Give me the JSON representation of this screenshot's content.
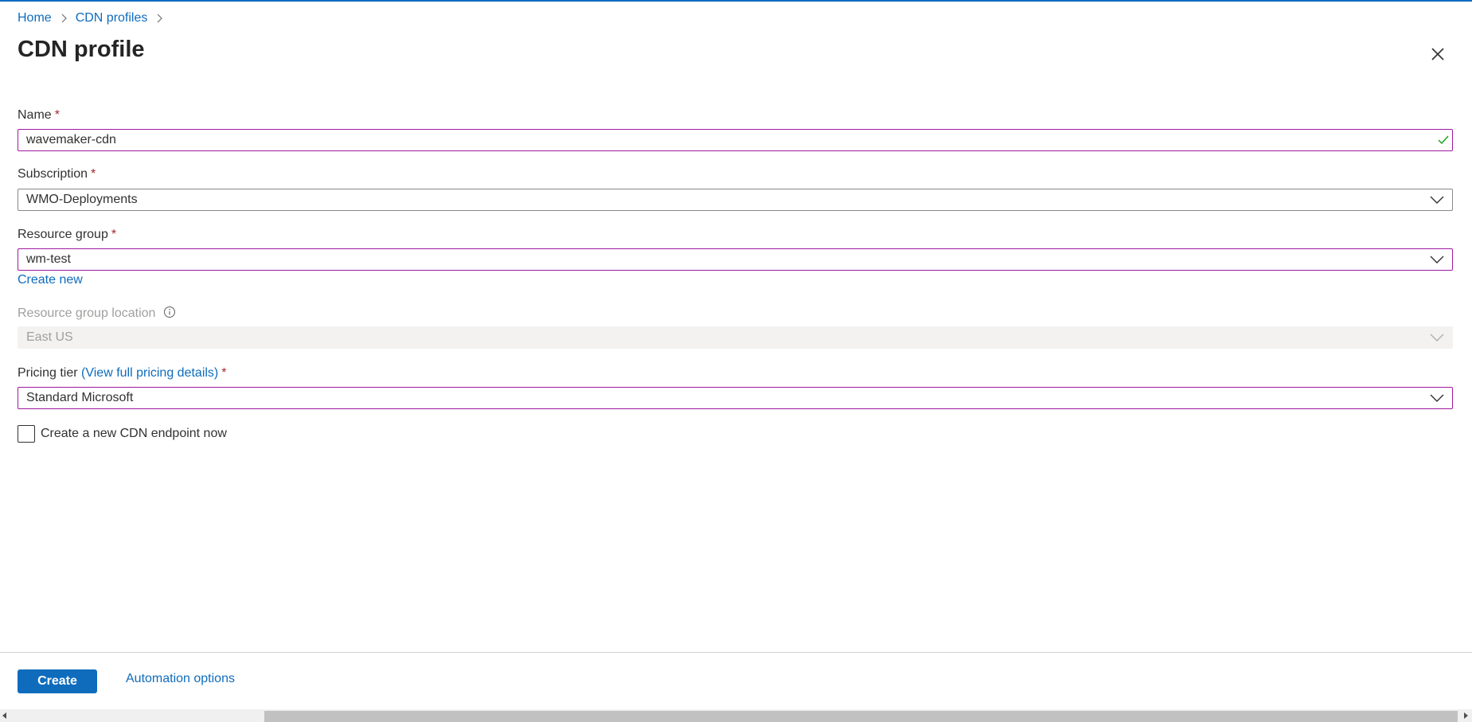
{
  "breadcrumb": {
    "items": [
      {
        "label": "Home"
      },
      {
        "label": "CDN profiles"
      }
    ]
  },
  "header": {
    "title": "CDN profile"
  },
  "form": {
    "name": {
      "label": "Name",
      "required_mark": "*",
      "value": "wavemaker-cdn",
      "status_icon": "check-icon"
    },
    "subscription": {
      "label": "Subscription",
      "required_mark": "*",
      "selected": "WMO-Deployments"
    },
    "resource_group": {
      "label": "Resource group",
      "required_mark": "*",
      "selected": "wm-test",
      "create_new_label": "Create new"
    },
    "resource_group_location": {
      "label": "Resource group location",
      "selected": "East US",
      "disabled": true
    },
    "pricing_tier": {
      "label": "Pricing tier",
      "paren_open": "(",
      "link_label": "View full pricing details",
      "paren_close": ")",
      "required_mark": "*",
      "selected": "Standard Microsoft"
    },
    "create_endpoint": {
      "label": "Create a new CDN endpoint now",
      "checked": false
    }
  },
  "footer": {
    "create_label": "Create",
    "automation_label": "Automation options"
  },
  "colors": {
    "accent": "#0f6cbd",
    "required": "#a4262c",
    "invalid_border": "#a0199f",
    "valid_check": "#13a10e"
  }
}
